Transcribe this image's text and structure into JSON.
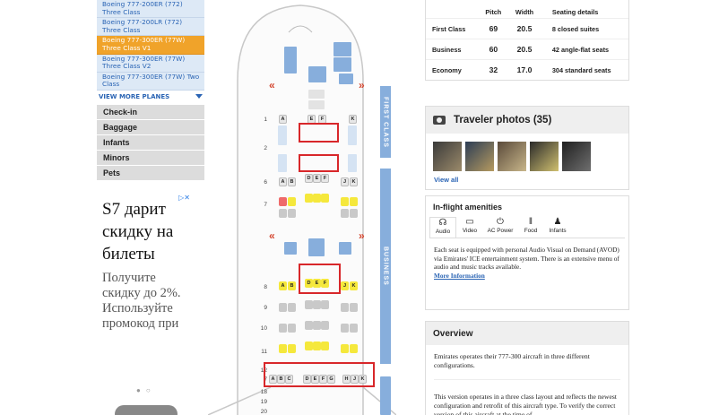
{
  "sidebar": {
    "planes": [
      {
        "label": "Boeing 777-200ER (772) Three Class",
        "active": false
      },
      {
        "label": "Boeing 777-200LR (772) Three Class",
        "active": false
      },
      {
        "label": "Boeing 777-300ER (77W) Three Class V1",
        "active": true
      },
      {
        "label": "Boeing 777-300ER (77W) Three Class V2",
        "active": false
      },
      {
        "label": "Boeing 777-300ER (77W) Two Class",
        "active": false
      }
    ],
    "view_more": "VIEW MORE PLANES",
    "menu": [
      "Check-in",
      "Baggage",
      "Infants",
      "Minors",
      "Pets"
    ]
  },
  "ad": {
    "close": "▷✕",
    "title": "S7 дарит скидку на билеты",
    "subtitle": "Получите скидку до 2%. Используйте промокод при",
    "dots": "●○"
  },
  "seatmap": {
    "first_label": "FIRST CLASS",
    "business_label": "BUSINESS",
    "row_numbers": [
      "1",
      "2",
      "6",
      "7",
      "8",
      "9",
      "10",
      "11",
      "12",
      "7",
      "18",
      "19",
      "20"
    ],
    "seat_letters_first": [
      "A",
      "E",
      "F",
      "K"
    ],
    "seat_letters_6": [
      "A",
      "B",
      "D",
      "E",
      "F",
      "J",
      "K"
    ],
    "seat_letters_8": [
      "A",
      "B",
      "D",
      "E",
      "F",
      "J",
      "K"
    ],
    "seat_letters_eco": [
      "A",
      "B",
      "C",
      "D",
      "E",
      "F",
      "G",
      "H",
      "J",
      "K"
    ],
    "chevron_left": "«",
    "chevron_right": "»",
    "colors": {
      "blue": "#87aedc",
      "yellow": "#f5e83c",
      "highlight": "#d8272a"
    }
  },
  "classes": {
    "headers": [
      "Pitch",
      "Width",
      "Seating details"
    ],
    "rows": [
      {
        "name": "First Class",
        "pitch": "69",
        "width": "20.5",
        "details": "8 closed suites"
      },
      {
        "name": "Business",
        "pitch": "60",
        "width": "20.5",
        "details": "42 angle-flat seats"
      },
      {
        "name": "Economy",
        "pitch": "32",
        "width": "17.0",
        "details": "304 standard seats"
      }
    ]
  },
  "photos": {
    "title": "Traveler photos (35)",
    "view_all": "View all"
  },
  "amenities": {
    "title": "In-flight amenities",
    "tabs": [
      {
        "label": "Audio",
        "icon": "☊"
      },
      {
        "label": "Video",
        "icon": "▭"
      },
      {
        "label": "AC Power",
        "icon": "⏻"
      },
      {
        "label": "Food",
        "icon": "‖"
      },
      {
        "label": "Infants",
        "icon": "♟"
      }
    ],
    "text": "Each seat is equipped with personal Audio Visual on Demand (AVOD) via Emirates' ICE entertainment system. There is an extensive menu of audio and music tracks available.",
    "link": "More Information"
  },
  "overview": {
    "title": "Overview",
    "p1": "Emirates operates their 777-300 aircraft in three different configurations.",
    "p2": "This version operates in a three class layout and reflects the newest configuration and retrofit of this aircraft type. To verify the correct version of this aircraft at the time of"
  }
}
